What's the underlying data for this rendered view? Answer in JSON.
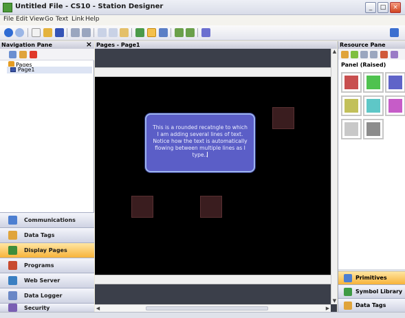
{
  "window": {
    "title": "Untitled File - CS10 - Station Designer",
    "min_glyph": "_",
    "max_glyph": "□",
    "close_glyph": "×"
  },
  "menu": [
    "File",
    "Edit",
    "View",
    "Go",
    "Text",
    "Link",
    "Help"
  ],
  "navigation_pane": {
    "title": "Navigation Pane",
    "close_glyph": "×",
    "tree_root": "Pages",
    "tree_child": "Page1",
    "buttons": [
      {
        "label": "Communications",
        "icon": "communications-icon",
        "color": "#4d7fd1",
        "active": false
      },
      {
        "label": "Data Tags",
        "icon": "data-tags-icon",
        "color": "#e0a43b",
        "active": false
      },
      {
        "label": "Display Pages",
        "icon": "display-pages-icon",
        "color": "#3e8d3a",
        "active": true
      },
      {
        "label": "Programs",
        "icon": "programs-icon",
        "color": "#c84a2f",
        "active": false
      },
      {
        "label": "Web Server",
        "icon": "web-server-icon",
        "color": "#3a7fc2",
        "active": false
      },
      {
        "label": "Data Logger",
        "icon": "data-logger-icon",
        "color": "#6a87c6",
        "active": false
      },
      {
        "label": "Security",
        "icon": "security-icon",
        "color": "#7a5fb3",
        "active": false
      }
    ]
  },
  "editor": {
    "title": "Pages - Page1",
    "text_box": "This is a rounded recatngle to which I am adding several lines of text. Notice how the text is automatically flowing between multiple lines as I type..",
    "scroll_up": "▲",
    "scroll_down": "▼",
    "scroll_left": "◀",
    "scroll_right": "▶"
  },
  "resource_pane": {
    "title": "Resource Pane",
    "panel_label": "Panel (Raised)",
    "swatches": [
      "#c84f4f",
      "#4fc24f",
      "#5f64c8",
      "#c2c05a",
      "#5ec7c7",
      "#c65cc8",
      "#c8c8c8",
      "#8c8c8c"
    ],
    "buttons": [
      {
        "label": "Primitives",
        "icon": "primitives-icon",
        "color": "#4d7fd1",
        "active": true
      },
      {
        "label": "Symbol Library",
        "icon": "symbol-library-icon",
        "color": "#3e9a44",
        "active": false
      },
      {
        "label": "Data Tags",
        "icon": "data-tags-icon",
        "color": "#e0a43b",
        "active": false
      }
    ]
  },
  "colors": {
    "active_button": "#f7b33a",
    "canvas": "#000000",
    "text_box_fill": "#5b5ec7",
    "dark_square": "#3a1d1f"
  }
}
